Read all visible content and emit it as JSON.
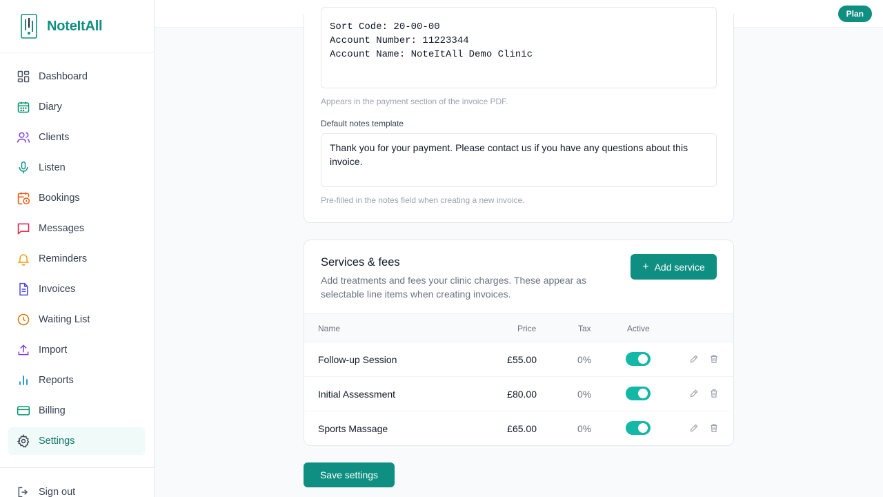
{
  "app": {
    "name": "NoteItAll"
  },
  "topbar": {
    "plan_label": "Plan"
  },
  "nav": [
    {
      "label": "Dashboard",
      "icon": "dashboard-icon",
      "color": "#4b5563"
    },
    {
      "label": "Diary",
      "icon": "calendar-icon",
      "color": "#059669"
    },
    {
      "label": "Clients",
      "icon": "users-icon",
      "color": "#7c3aed"
    },
    {
      "label": "Listen",
      "icon": "microphone-icon",
      "color": "#0d9488"
    },
    {
      "label": "Bookings",
      "icon": "calendar-clock-icon",
      "color": "#ea580c"
    },
    {
      "label": "Messages",
      "icon": "message-icon",
      "color": "#e11d48"
    },
    {
      "label": "Reminders",
      "icon": "bell-icon",
      "color": "#f59e0b"
    },
    {
      "label": "Invoices",
      "icon": "document-icon",
      "color": "#4f46e5"
    },
    {
      "label": "Waiting List",
      "icon": "clock-icon",
      "color": "#d97706"
    },
    {
      "label": "Import",
      "icon": "upload-icon",
      "color": "#7c3aed"
    },
    {
      "label": "Reports",
      "icon": "bar-chart-icon",
      "color": "#0284c7"
    },
    {
      "label": "Billing",
      "icon": "credit-card-icon",
      "color": "#059669"
    },
    {
      "label": "Settings",
      "icon": "gear-icon",
      "color": "#374151"
    }
  ],
  "signout_label": "Sign out",
  "payment": {
    "lines": [
      "Sort Code: 20-00-00",
      "Account Number: 11223344",
      "Account Name: NoteItAll Demo Clinic"
    ],
    "hint": "Appears in the payment section of the invoice PDF."
  },
  "notes": {
    "label": "Default notes template",
    "value": "Thank you for your payment. Please contact us if you have any questions about this invoice.",
    "hint": "Pre-filled in the notes field when creating a new invoice."
  },
  "services": {
    "title": "Services & fees",
    "description": "Add treatments and fees your clinic charges. These appear as selectable line items when creating invoices.",
    "add_label": "Add service",
    "columns": {
      "name": "Name",
      "price": "Price",
      "tax": "Tax",
      "active": "Active"
    },
    "rows": [
      {
        "name": "Follow-up Session",
        "price": "£55.00",
        "tax": "0%",
        "active": true
      },
      {
        "name": "Initial Assessment",
        "price": "£80.00",
        "tax": "0%",
        "active": true
      },
      {
        "name": "Sports Massage",
        "price": "£65.00",
        "tax": "0%",
        "active": true
      }
    ]
  },
  "save_label": "Save settings",
  "colors": {
    "brand": "#0f8f82",
    "toggle_on": "#14b8a6"
  }
}
